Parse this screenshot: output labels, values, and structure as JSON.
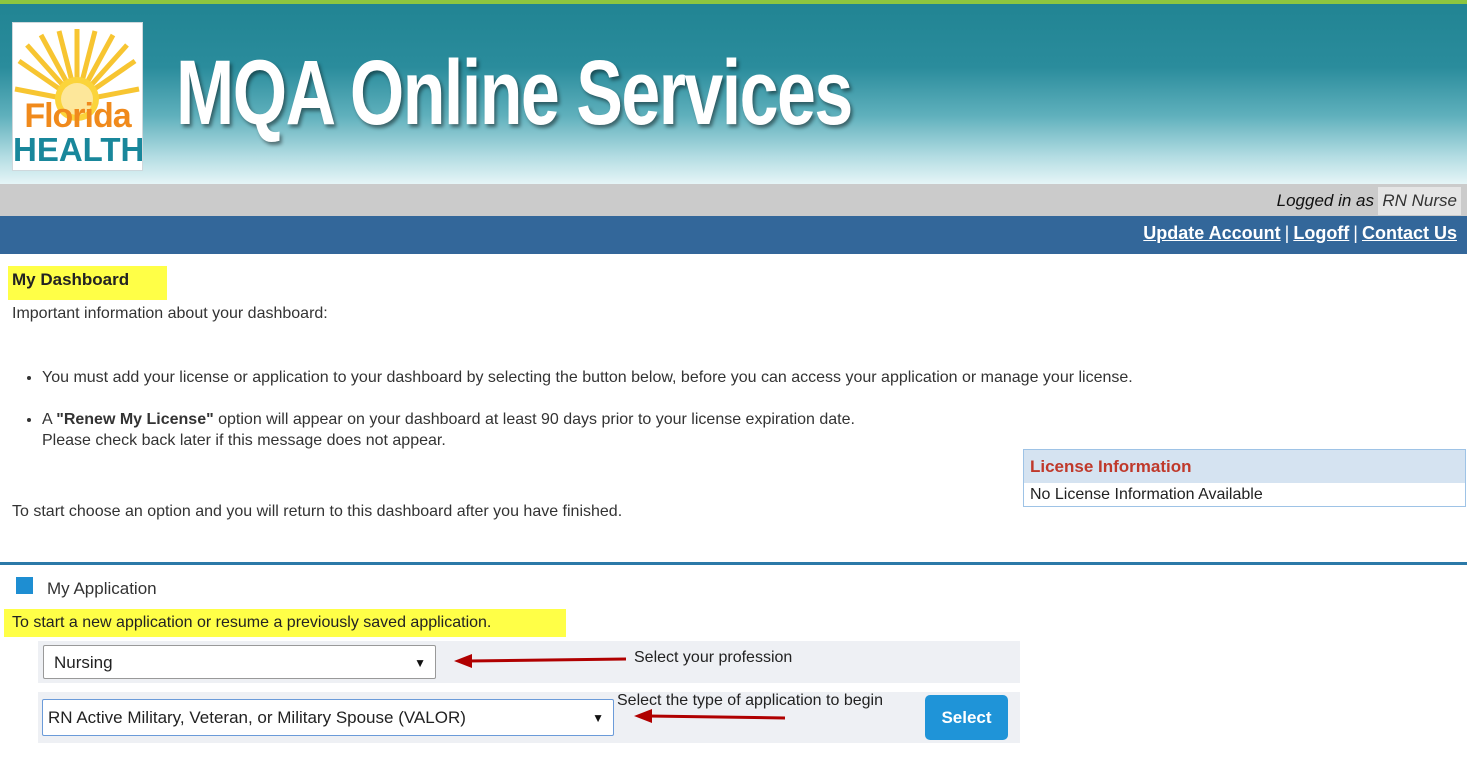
{
  "header": {
    "logo_line1": "Florida",
    "logo_line2": "HEALTH",
    "site_title": "MQA Online Services",
    "logged_in_label": "Logged in as",
    "logged_in_user": "RN Nurse"
  },
  "nav": {
    "update_account": "Update Account",
    "separator": "|",
    "logoff": "Logoff",
    "contact_us": "Contact Us"
  },
  "dashboard": {
    "title": "My Dashboard",
    "info": "Important information about your dashboard:",
    "bullet1": "You must add your license or application to your dashboard by selecting the button below, before you can access your application or manage your license.",
    "bullet2_prefix": "A ",
    "bullet2_bold": "\"Renew My License\"",
    "bullet2_suffix": " option will appear on your dashboard at least 90 days prior to your license expiration date.",
    "bullet2_line2": "Please check back later if this message does not appear.",
    "start_text": "To start choose an option and you will return to this dashboard after you have finished."
  },
  "license": {
    "title": "License Information",
    "body": "No License Information Available"
  },
  "application": {
    "title": "My Application",
    "hint": "To start a new application or resume a previously saved application.",
    "profession_value": "Nursing",
    "profession_annotation": "Select your profession",
    "type_value": "RN Active Military, Veteran, or Military Spouse (VALOR)",
    "type_annotation": "Select the type of application to begin",
    "select_button": "Select",
    "dropdown_glyph": "▼"
  },
  "colors": {
    "banner": "#218493",
    "navbar": "#33679a",
    "highlight": "#ffff47",
    "button": "#1f94d8",
    "license_title": "#c0392b",
    "annotation_arrow": "#b00000"
  }
}
